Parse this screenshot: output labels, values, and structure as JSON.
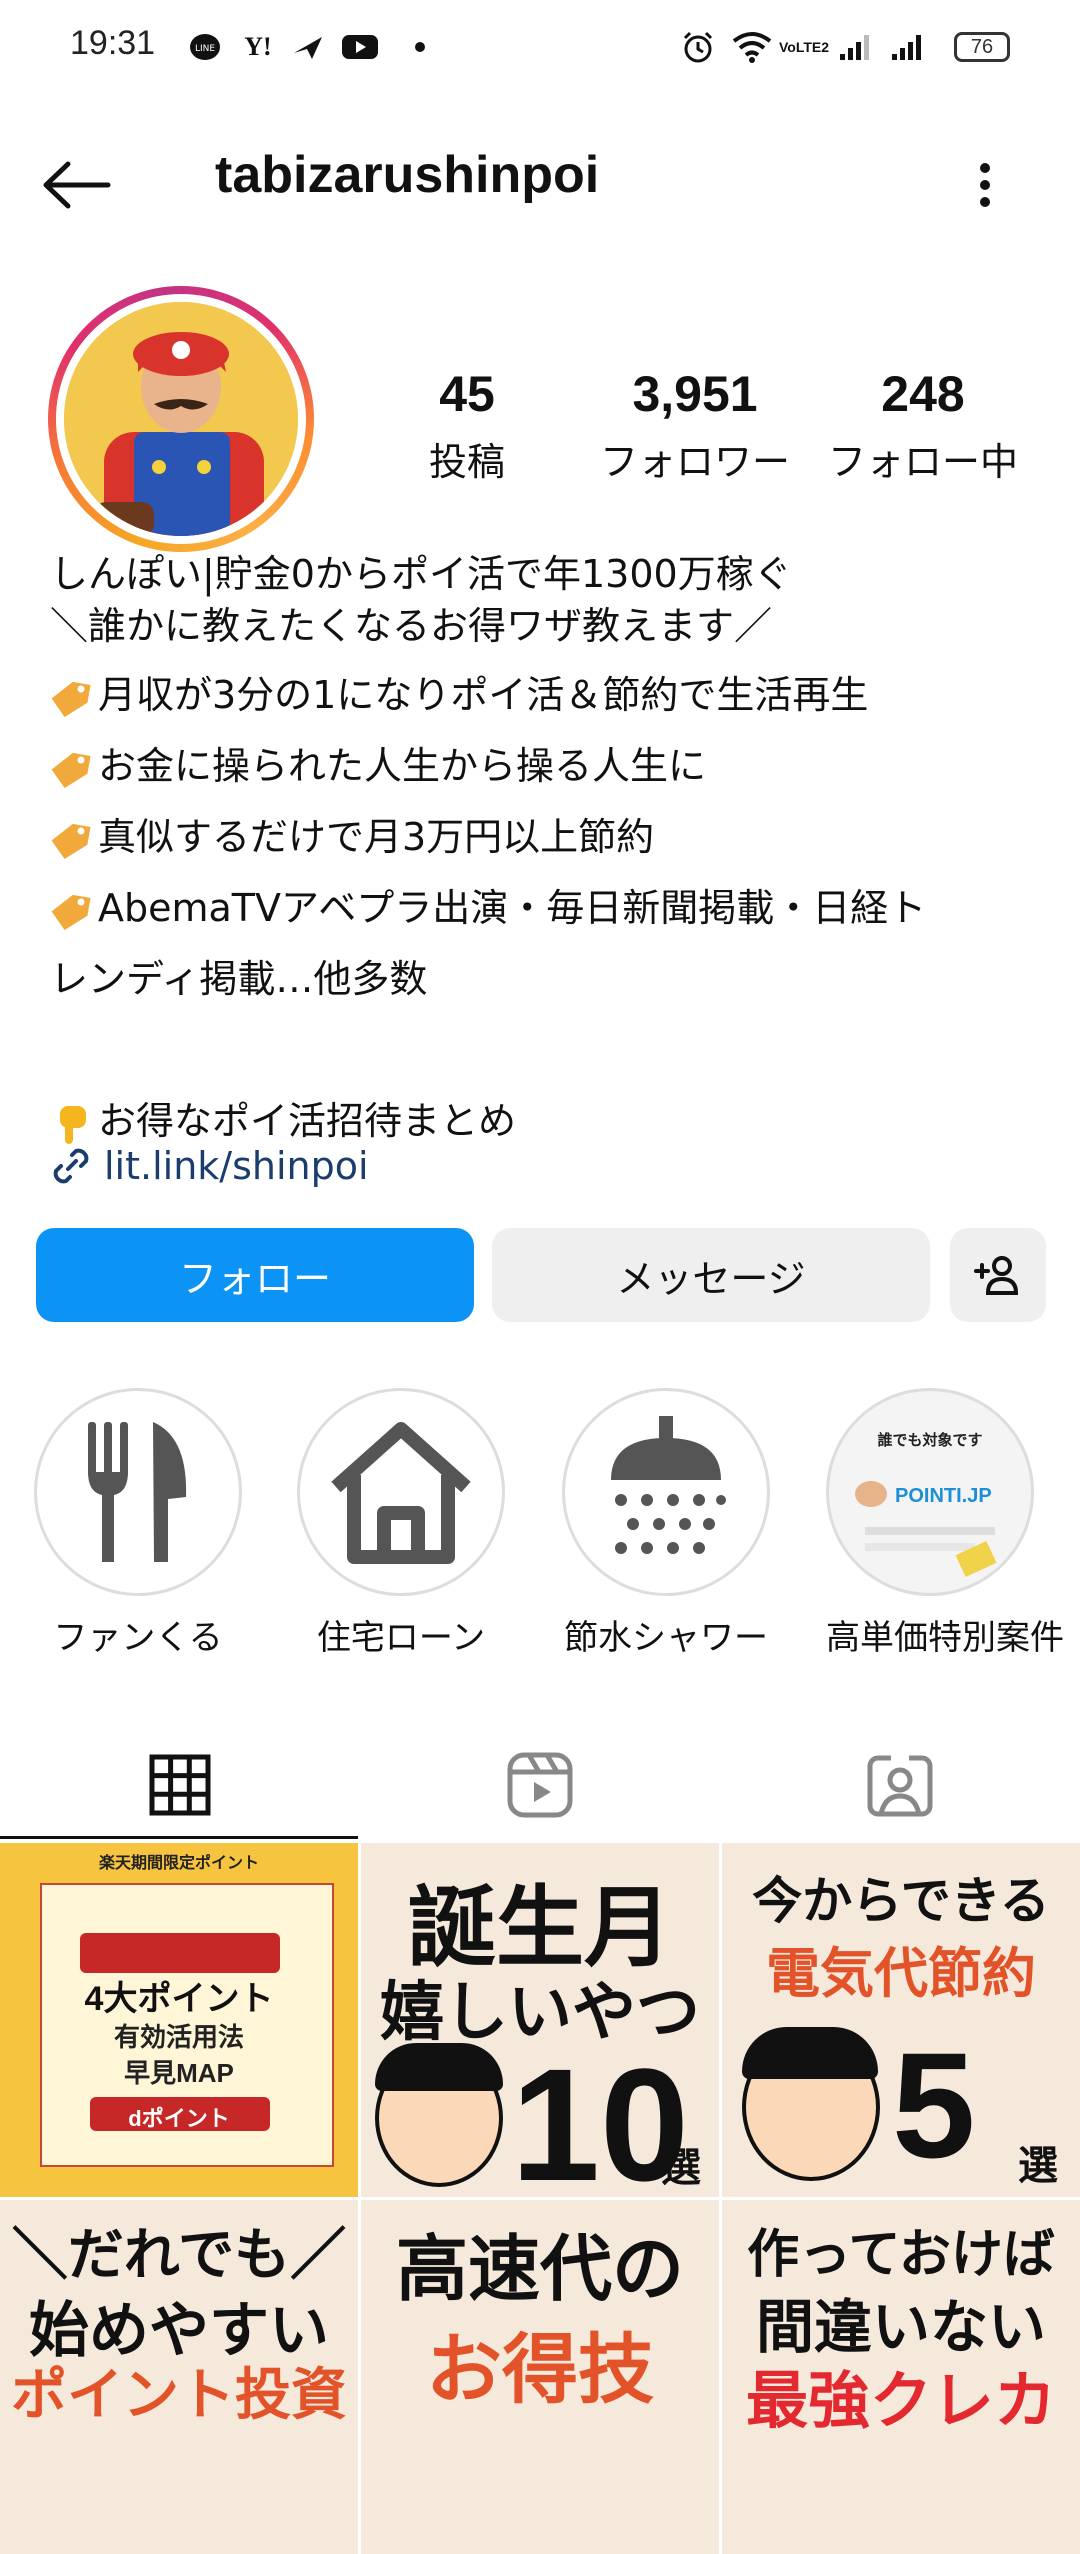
{
  "status_bar": {
    "time": "19:31",
    "battery": "76",
    "icons": [
      "line-icon",
      "yahoo-icon",
      "paper-plane-icon",
      "youtube-icon",
      "dot-icon",
      "alarm-icon",
      "wifi-icon",
      "volte-icon",
      "signal-icon",
      "signal-icon",
      "battery-icon"
    ],
    "volte_label": "VoLTE2"
  },
  "header": {
    "username": "tabizarushinpoi"
  },
  "stats": [
    {
      "value": "45",
      "label": "投稿"
    },
    {
      "value": "3,951",
      "label": "フォロワー"
    },
    {
      "value": "248",
      "label": "フォロー中"
    }
  ],
  "bio": {
    "name": "しんぽい|貯金0からポイ活で年1300万稼ぐ",
    "subtitle": "＼誰かに教えたくなるお得ワザ教えます／",
    "line1": "月収が3分の1になりポイ活＆節約で生活再生",
    "line2": "お金に操られた人生から操る人生に",
    "line3": "真似するだけで月3万円以上節約",
    "line4a": "AbemaTVアベプラ出演・毎日新聞掲載・日経ト",
    "line4b": "レンディ掲載…他多数",
    "line5": "お得なポイ活招待まとめ",
    "link": "lit.link/shinpoi"
  },
  "buttons": {
    "follow": "フォロー",
    "message": "メッセージ"
  },
  "highlights": [
    {
      "label": "ファンくる",
      "icon": "fork-knife-icon"
    },
    {
      "label": "住宅ローン",
      "icon": "house-icon"
    },
    {
      "label": "節水シャワー",
      "icon": "shower-icon"
    },
    {
      "label": "高単価特別案件",
      "icon": "pointi-thumbnail",
      "thumb_lines": [
        "誰でも対象です",
        "POINTI.JP"
      ]
    }
  ],
  "tabs": [
    "grid-icon",
    "reels-icon",
    "tagged-icon"
  ],
  "posts": [
    {
      "lines": [
        "楽天期間限定ポイント",
        "4大ポイント",
        "有効活用法",
        "早見MAP",
        "dポイント"
      ],
      "bg": "#f6c43f"
    },
    {
      "lines": [
        "誕生月",
        "嬉しいやつ",
        "10",
        "選"
      ],
      "bg": "#ffffff"
    },
    {
      "lines": [
        "今からできる",
        "電気代節約",
        "5",
        "選"
      ],
      "bg": "#ffffff"
    },
    {
      "lines": [
        "＼だれでも／",
        "始めやすい",
        "ポイント投資"
      ],
      "bg": "#ffffff"
    },
    {
      "lines": [
        "高速代の",
        "お得技"
      ],
      "bg": "#ffffff"
    },
    {
      "lines": [
        "作っておけば",
        "間違いない",
        "最強クレカ"
      ],
      "bg": "#ffffff"
    }
  ],
  "colors": {
    "follow": "#0b93f6",
    "secondary_btn": "#efefef",
    "link": "#1a3d6e"
  }
}
